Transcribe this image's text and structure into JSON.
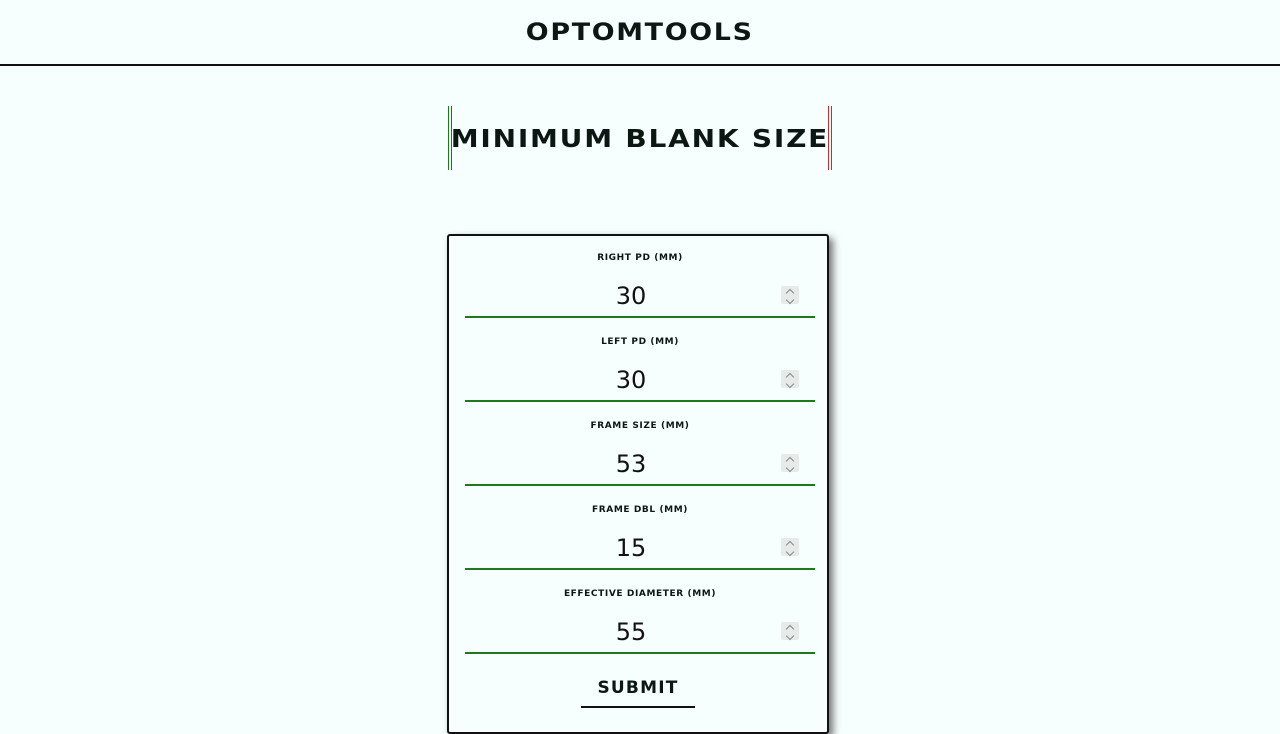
{
  "header": {
    "brand": "OPTOMTOOLS"
  },
  "page": {
    "title": "MINIMUM BLANK SIZE"
  },
  "form": {
    "fields": [
      {
        "label": "RIGHT PD (MM)",
        "value": "30"
      },
      {
        "label": "LEFT PD (MM)",
        "value": "30"
      },
      {
        "label": "FRAME SIZE (MM)",
        "value": "53"
      },
      {
        "label": "FRAME DBL (MM)",
        "value": "15"
      },
      {
        "label": "EFFECTIVE DIAMETER (MM)",
        "value": "55"
      }
    ],
    "submit_label": "SUBMIT"
  },
  "colors": {
    "background": "#f7fefe",
    "accent_green": "#1c7a1c",
    "accent_red": "#c03030",
    "text": "#0c1714"
  }
}
